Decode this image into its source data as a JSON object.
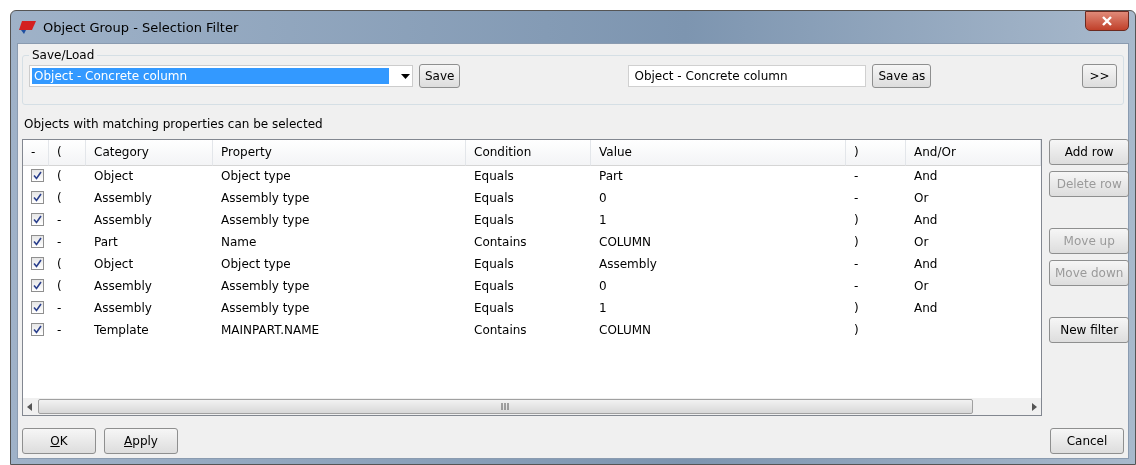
{
  "window": {
    "title": "Object Group - Selection Filter"
  },
  "save_load": {
    "label": "Save/Load",
    "dropdown_value": "Object - Concrete column",
    "save_button": "Save",
    "name_field_value": "Object - Concrete column",
    "save_as_button": "Save as",
    "expand_button": ">>"
  },
  "hint": "Objects with matching properties can be selected",
  "table": {
    "columns": [
      "-",
      "(",
      "Category",
      "Property",
      "Condition",
      "Value",
      ")",
      "And/Or"
    ],
    "rows": [
      {
        "checked": true,
        "open": "(",
        "category": "Object",
        "property": "Object type",
        "condition": "Equals",
        "value": "Part",
        "close": "-",
        "and_or": "And"
      },
      {
        "checked": true,
        "open": "(",
        "category": "Assembly",
        "property": "Assembly type",
        "condition": "Equals",
        "value": "0",
        "close": "-",
        "and_or": "Or"
      },
      {
        "checked": true,
        "open": "-",
        "category": "Assembly",
        "property": "Assembly type",
        "condition": "Equals",
        "value": "1",
        "close": ")",
        "and_or": "And"
      },
      {
        "checked": true,
        "open": "-",
        "category": "Part",
        "property": "Name",
        "condition": "Contains",
        "value": "COLUMN",
        "close": ")",
        "and_or": "Or"
      },
      {
        "checked": true,
        "open": "(",
        "category": "Object",
        "property": "Object type",
        "condition": "Equals",
        "value": "Assembly",
        "close": "-",
        "and_or": "And"
      },
      {
        "checked": true,
        "open": "(",
        "category": "Assembly",
        "property": "Assembly type",
        "condition": "Equals",
        "value": "0",
        "close": "-",
        "and_or": "Or"
      },
      {
        "checked": true,
        "open": "-",
        "category": "Assembly",
        "property": "Assembly type",
        "condition": "Equals",
        "value": "1",
        "close": ")",
        "and_or": "And"
      },
      {
        "checked": true,
        "open": "-",
        "category": "Template",
        "property": "MAINPART.NAME",
        "condition": "Contains",
        "value": "COLUMN",
        "close": ")"
      }
    ]
  },
  "side_button_groups": [
    [
      {
        "label": "Add row",
        "disabled": false
      },
      {
        "label": "Delete row",
        "disabled": true
      }
    ],
    [
      {
        "label": "Move up",
        "disabled": true
      },
      {
        "label": "Move down",
        "disabled": true
      }
    ],
    [
      {
        "label": "New filter",
        "disabled": false
      }
    ]
  ],
  "footer_buttons": [
    {
      "label": "OK",
      "mnemonic": true
    },
    {
      "label": "Apply",
      "mnemonic": true
    }
  ],
  "cancel_button": "Cancel"
}
